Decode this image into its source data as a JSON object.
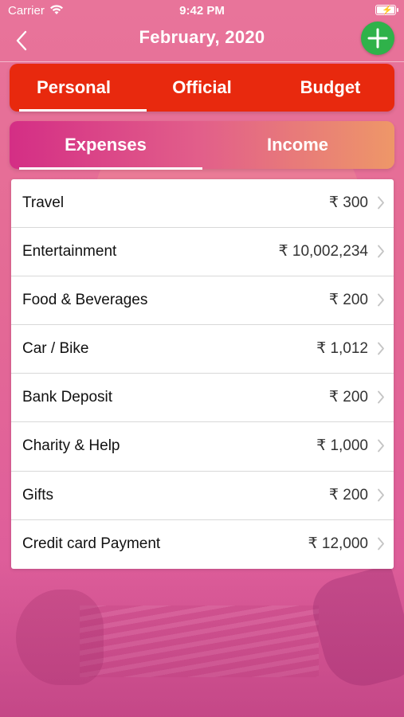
{
  "status_bar": {
    "carrier": "Carrier",
    "time": "9:42 PM",
    "icons": [
      "wifi-icon",
      "battery-charging-icon"
    ]
  },
  "nav": {
    "title": "February, 2020",
    "back_icon": "chevron-left-icon",
    "add_icon": "plus-icon",
    "add_color": "#2fb24a"
  },
  "category_tabs": [
    {
      "label": "Personal",
      "selected": true
    },
    {
      "label": "Official",
      "selected": false
    },
    {
      "label": "Budget",
      "selected": false
    }
  ],
  "type_tabs": [
    {
      "label": "Expenses",
      "selected": true
    },
    {
      "label": "Income",
      "selected": false
    }
  ],
  "currency_symbol": "₹",
  "expenses": [
    {
      "label": "Travel",
      "amount": "₹ 300"
    },
    {
      "label": "Entertainment",
      "amount": "₹ 10,002,234"
    },
    {
      "label": "Food & Beverages",
      "amount": "₹ 200"
    },
    {
      "label": "Car / Bike",
      "amount": "₹ 1,012"
    },
    {
      "label": "Bank Deposit",
      "amount": "₹ 200"
    },
    {
      "label": "Charity & Help",
      "amount": "₹ 1,000"
    },
    {
      "label": "Gifts",
      "amount": "₹ 200"
    },
    {
      "label": "Credit card Payment",
      "amount": "₹ 12,000"
    }
  ],
  "colors": {
    "category_bar": "#e8290e",
    "type_bar_start": "#d42e85",
    "type_bar_end": "#ee9768",
    "background": "#e46a95"
  }
}
